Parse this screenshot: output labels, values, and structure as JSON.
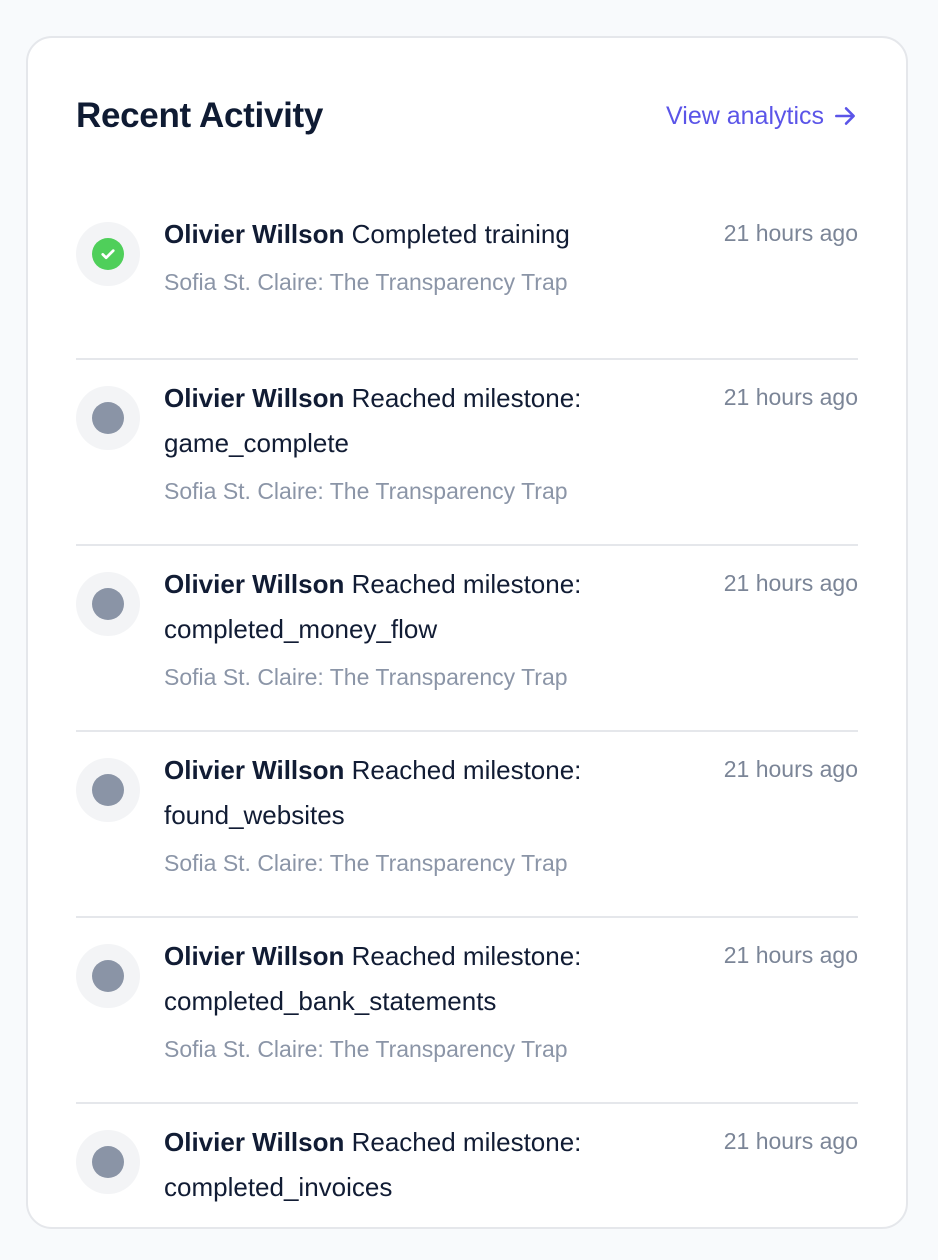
{
  "header": {
    "title": "Recent Activity",
    "link_label": "View analytics",
    "link_icon": "arrow-right-icon"
  },
  "colors": {
    "accent": "#5b55e8",
    "success": "#4fcf5a",
    "neutral_dot": "#8a94a6"
  },
  "activities": [
    {
      "status": "success",
      "icon": "check-icon",
      "actor": "Olivier Willson",
      "action": "Completed training",
      "detail": "",
      "subtitle": "Sofia St. Claire: The Transparency Trap",
      "time": "21 hours ago"
    },
    {
      "status": "neutral",
      "icon": "dot-icon",
      "actor": "Olivier Willson",
      "action": "Reached milestone:",
      "detail": "game_complete",
      "subtitle": "Sofia St. Claire: The Transparency Trap",
      "time": "21 hours ago"
    },
    {
      "status": "neutral",
      "icon": "dot-icon",
      "actor": "Olivier Willson",
      "action": "Reached milestone:",
      "detail": "completed_money_flow",
      "subtitle": "Sofia St. Claire: The Transparency Trap",
      "time": "21 hours ago"
    },
    {
      "status": "neutral",
      "icon": "dot-icon",
      "actor": "Olivier Willson",
      "action": "Reached milestone:",
      "detail": "found_websites",
      "subtitle": "Sofia St. Claire: The Transparency Trap",
      "time": "21 hours ago"
    },
    {
      "status": "neutral",
      "icon": "dot-icon",
      "actor": "Olivier Willson",
      "action": "Reached milestone:",
      "detail": "completed_bank_statements",
      "subtitle": "Sofia St. Claire: The Transparency Trap",
      "time": "21 hours ago"
    },
    {
      "status": "neutral",
      "icon": "dot-icon",
      "actor": "Olivier Willson",
      "action": "Reached milestone:",
      "detail": "completed_invoices",
      "subtitle": "",
      "time": "21 hours ago"
    }
  ]
}
